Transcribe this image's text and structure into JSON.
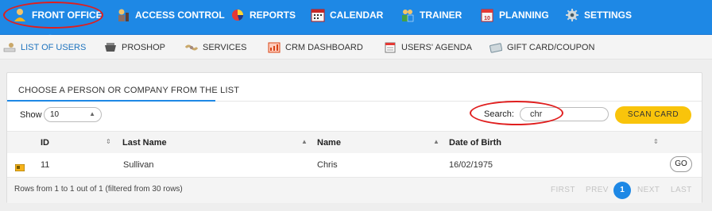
{
  "topnav": {
    "items": [
      {
        "label": "FRONT OFFICE",
        "icon": "front-office-icon",
        "active": true
      },
      {
        "label": "ACCESS CONTROL",
        "icon": "access-control-icon"
      },
      {
        "label": "REPORTS",
        "icon": "reports-pie-icon"
      },
      {
        "label": "CALENDAR",
        "icon": "calendar-icon"
      },
      {
        "label": "TRAINER",
        "icon": "trainer-icon"
      },
      {
        "label": "PLANNING",
        "icon": "planning-icon"
      },
      {
        "label": "SETTINGS",
        "icon": "settings-gear-icon"
      }
    ]
  },
  "subnav": {
    "items": [
      {
        "label": "LIST OF USERS",
        "icon": "users-list-icon",
        "active": true
      },
      {
        "label": "PROSHOP",
        "icon": "proshop-icon"
      },
      {
        "label": "SERVICES",
        "icon": "services-icon"
      },
      {
        "label": "CRM DASHBOARD",
        "icon": "crm-dashboard-icon"
      },
      {
        "label": "USERS' AGENDA",
        "icon": "agenda-icon"
      },
      {
        "label": "GIFT CARD/COUPON",
        "icon": "gift-card-icon"
      }
    ]
  },
  "panel": {
    "title": "CHOOSE A PERSON OR COMPANY FROM THE LIST",
    "show_label": "Show",
    "show_value": "10",
    "search_label": "Search:",
    "search_value": "chr",
    "scan_label": "SCAN CARD"
  },
  "table": {
    "columns": [
      "ID",
      "Last Name",
      "Name",
      "Date of Birth"
    ],
    "rows": [
      {
        "id": "11",
        "last_name": "Sullivan",
        "name": "Chris",
        "dob": "16/02/1975",
        "action": "GO"
      }
    ],
    "footer_info": "Rows from 1 to 1 out of 1 (filtered from 30 rows)"
  },
  "pagination": {
    "first": "FIRST",
    "prev": "PREV",
    "current": "1",
    "next": "NEXT",
    "last": "LAST"
  },
  "colors": {
    "nav_blue": "#1e88e5",
    "accent_yellow": "#f9c40b",
    "highlight_red": "#e01e1e"
  }
}
